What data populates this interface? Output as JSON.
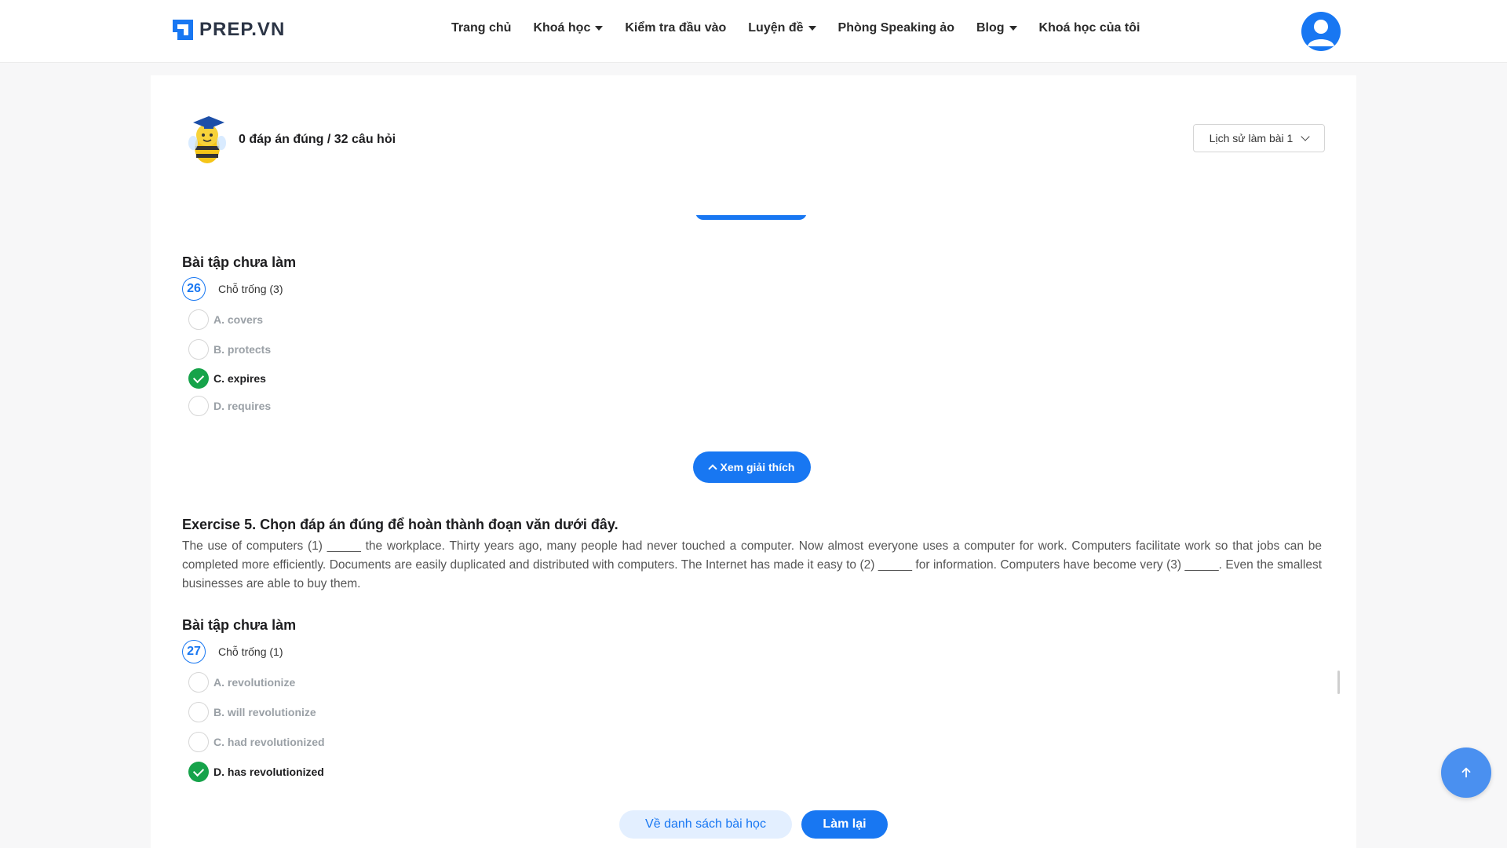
{
  "brand": {
    "name": "PREP.VN",
    "accent": "#1877f2",
    "success": "#16a34a"
  },
  "nav": {
    "items": [
      {
        "label": "Trang chủ",
        "dropdown": false
      },
      {
        "label": "Khoá học",
        "dropdown": true
      },
      {
        "label": "Kiểm tra đầu vào",
        "dropdown": false
      },
      {
        "label": "Luyện đề",
        "dropdown": true
      },
      {
        "label": "Phòng Speaking ảo",
        "dropdown": false
      },
      {
        "label": "Blog",
        "dropdown": true
      },
      {
        "label": "Khoá học của tôi",
        "dropdown": false
      }
    ]
  },
  "summary": {
    "score_text": "0 đáp án đúng / 32 câu hỏi"
  },
  "history": {
    "label": "Lịch sử làm bài 1"
  },
  "q26": {
    "section": "Bài tập chưa làm",
    "number": "26",
    "blank": "Chỗ trống (3)",
    "options": [
      "A. covers",
      "B. protects",
      "C. expires",
      "D. requires"
    ],
    "selected_index": 2
  },
  "explain_label": "Xem giải thích",
  "exercise5": {
    "title": "Exercise 5. Chọn đáp án đúng để hoàn thành đoạn văn dưới đây.",
    "passage": "The use of computers (1) _____ the workplace. Thirty years ago, many people had never touched a computer. Now almost everyone uses a computer for work. Computers facilitate work so that jobs can be completed more efficiently. Documents are easily duplicated and distributed with computers. The Internet has made it easy to (2) _____ for information. Computers have become very (3) _____. Even the smallest businesses are able to buy them."
  },
  "q27": {
    "section": "Bài tập chưa làm",
    "number": "27",
    "blank": "Chỗ trống (1)",
    "options": [
      "A. revolutionize",
      "B. will revolutionize",
      "C. had revolutionized",
      "D. has revolutionized"
    ],
    "selected_index": 3
  },
  "footer": {
    "back_label": "Về danh sách bài học",
    "redo_label": "Làm lại"
  }
}
